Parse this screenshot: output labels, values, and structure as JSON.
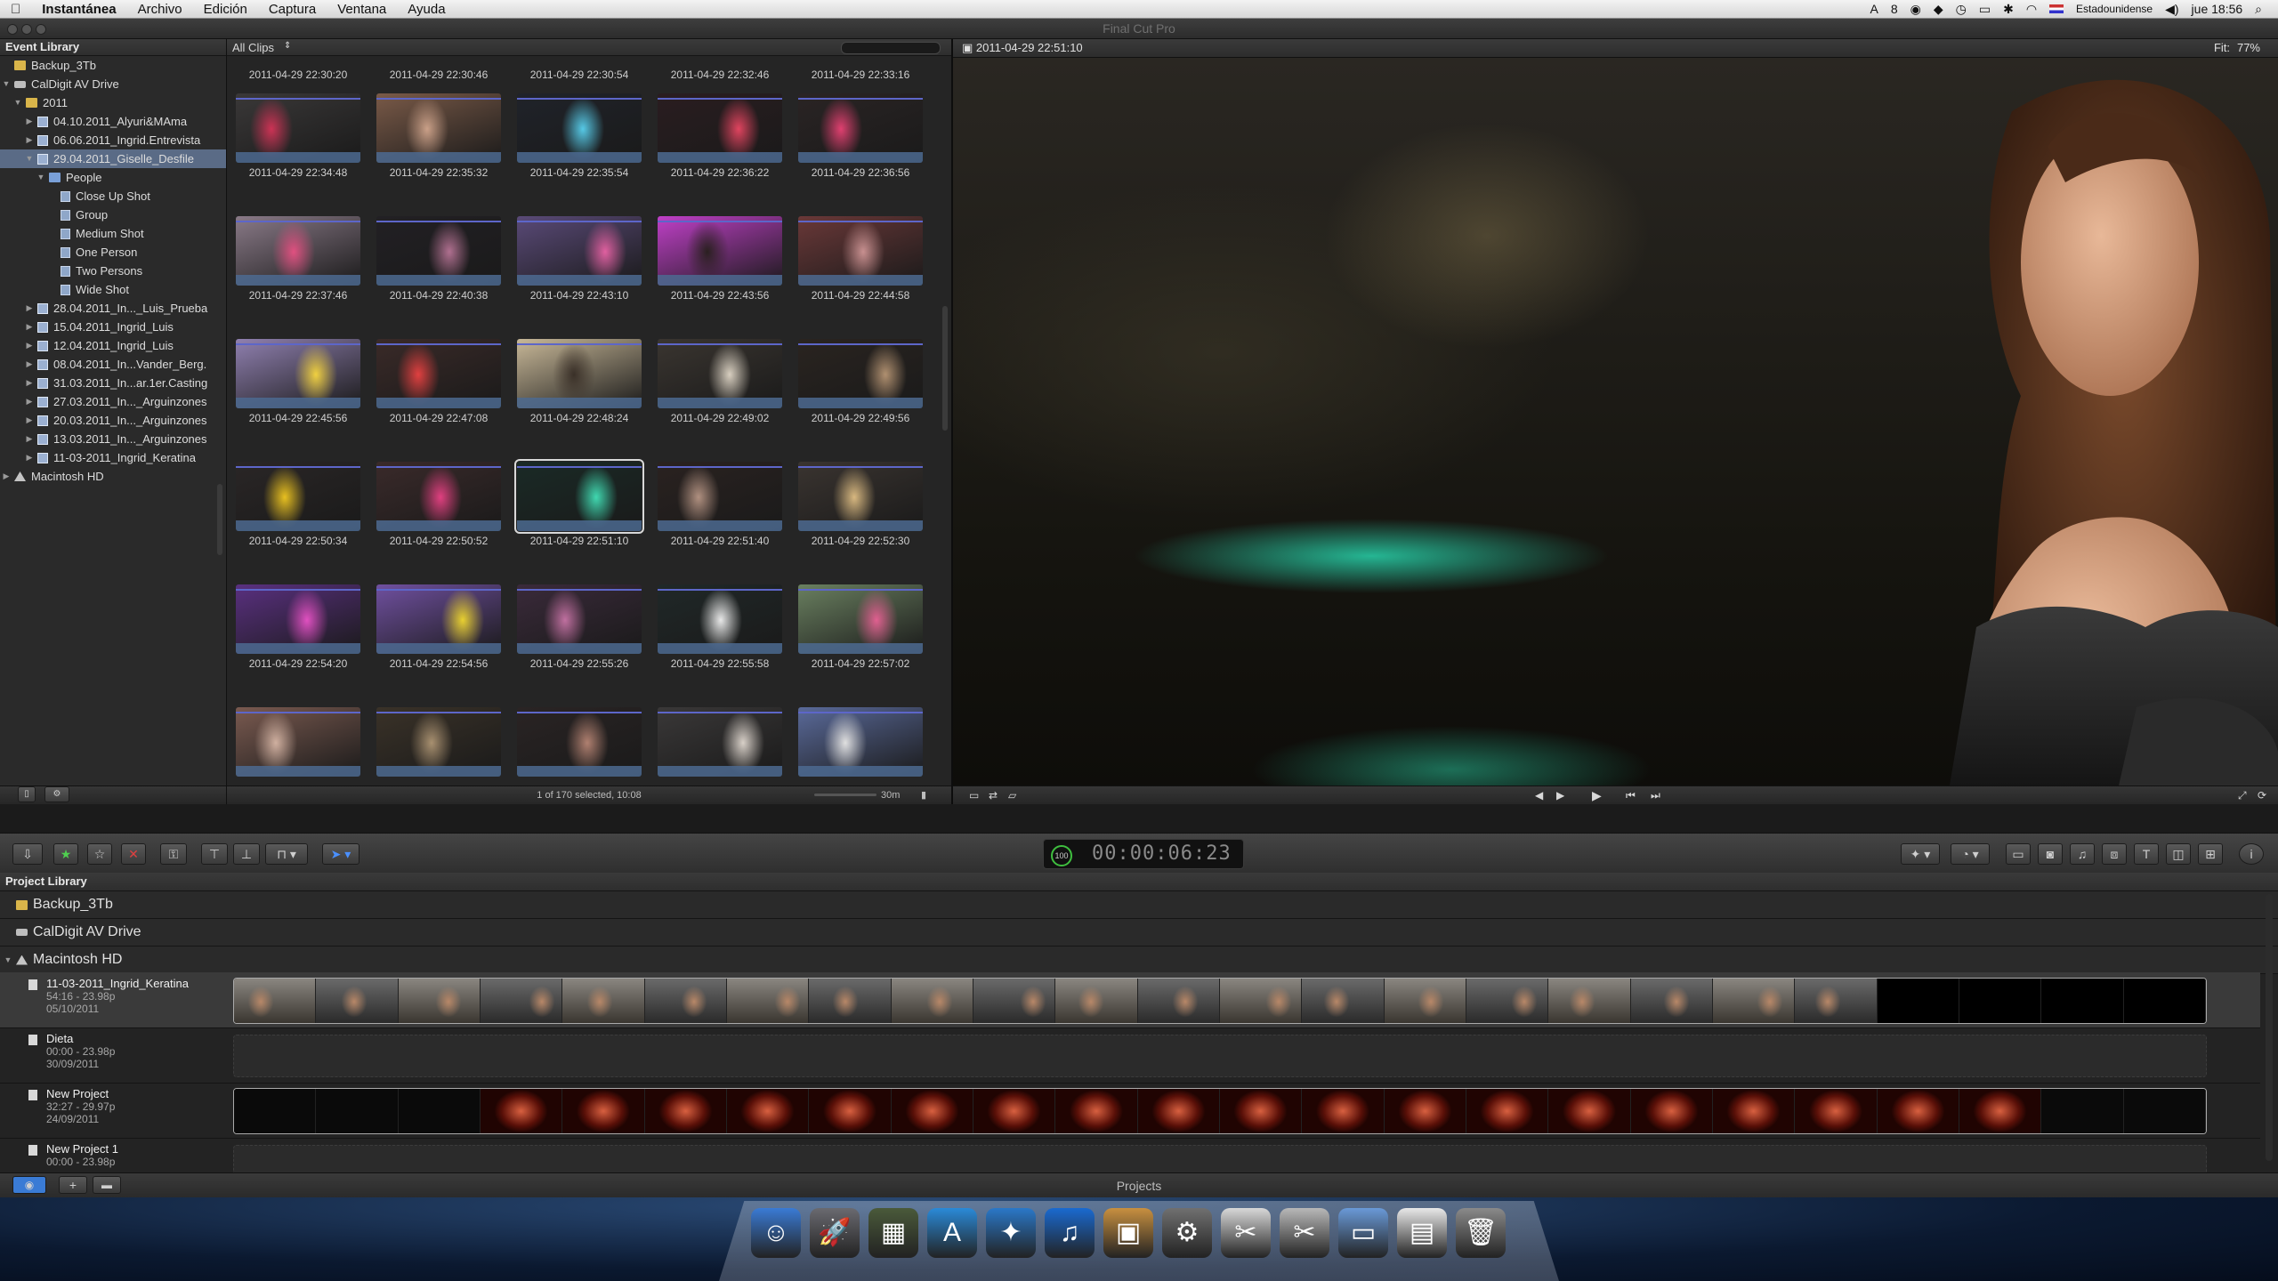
{
  "menubar": {
    "apple": "",
    "app": "Instantánea",
    "items": [
      "Archivo",
      "Edición",
      "Captura",
      "Ventana",
      "Ayuda"
    ],
    "status_count": "8",
    "input_source": "Estadounidense",
    "clock": "jue 18:56"
  },
  "window": {
    "title": "Final Cut Pro"
  },
  "event_library": {
    "title": "Event Library",
    "rows": [
      {
        "label": "Backup_3Tb",
        "icon": "folder",
        "indent": 0,
        "tri": ""
      },
      {
        "label": "CalDigit AV Drive",
        "icon": "drive",
        "indent": 0,
        "tri": "▼"
      },
      {
        "label": "2011",
        "icon": "folder",
        "indent": 1,
        "tri": "▼"
      },
      {
        "label": "04.10.2011_Alyuri&MAma",
        "icon": "event",
        "indent": 2,
        "tri": "▶"
      },
      {
        "label": "06.06.2011_Ingrid.Entrevista",
        "icon": "event",
        "indent": 2,
        "tri": "▶"
      },
      {
        "label": "29.04.2011_Giselle_Desfile",
        "icon": "event",
        "indent": 2,
        "tri": "▼",
        "selected": true
      },
      {
        "label": "People",
        "icon": "folder-blue",
        "indent": 3,
        "tri": "▼"
      },
      {
        "label": "Close Up Shot",
        "icon": "kw",
        "indent": 4,
        "tri": ""
      },
      {
        "label": "Group",
        "icon": "kw",
        "indent": 4,
        "tri": ""
      },
      {
        "label": "Medium Shot",
        "icon": "kw",
        "indent": 4,
        "tri": ""
      },
      {
        "label": "One Person",
        "icon": "kw",
        "indent": 4,
        "tri": ""
      },
      {
        "label": "Two Persons",
        "icon": "kw",
        "indent": 4,
        "tri": ""
      },
      {
        "label": "Wide Shot",
        "icon": "kw",
        "indent": 4,
        "tri": ""
      },
      {
        "label": "28.04.2011_In..._Luis_Prueba",
        "icon": "event",
        "indent": 2,
        "tri": "▶"
      },
      {
        "label": "15.04.2011_Ingrid_Luis",
        "icon": "event",
        "indent": 2,
        "tri": "▶"
      },
      {
        "label": "12.04.2011_Ingrid_Luis",
        "icon": "event",
        "indent": 2,
        "tri": "▶"
      },
      {
        "label": "08.04.2011_In...Vander_Berg.",
        "icon": "event",
        "indent": 2,
        "tri": "▶"
      },
      {
        "label": "31.03.2011_In...ar.1er.Casting",
        "icon": "event",
        "indent": 2,
        "tri": "▶"
      },
      {
        "label": "27.03.2011_In..._Arguinzones",
        "icon": "event",
        "indent": 2,
        "tri": "▶"
      },
      {
        "label": "20.03.2011_In..._Arguinzones",
        "icon": "event",
        "indent": 2,
        "tri": "▶"
      },
      {
        "label": "13.03.2011_In..._Arguinzones",
        "icon": "event",
        "indent": 2,
        "tri": "▶"
      },
      {
        "label": "11-03-2011_Ingrid_Keratina",
        "icon": "event",
        "indent": 2,
        "tri": "▶"
      },
      {
        "label": "Macintosh HD",
        "icon": "hd",
        "indent": 0,
        "tri": "▶"
      }
    ]
  },
  "browser": {
    "filter": "All Clips",
    "top_labels": [
      "2011-04-29 22:30:20",
      "2011-04-29 22:30:46",
      "2011-04-29 22:30:54",
      "2011-04-29 22:32:46",
      "2011-04-29 22:33:16"
    ],
    "clips": [
      {
        "label": "2011-04-29 22:34:48",
        "c1": "#3a3838",
        "c2": "#cc3355"
      },
      {
        "label": "2011-04-29 22:35:32",
        "c1": "#7a5a48",
        "c2": "#caa088"
      },
      {
        "label": "2011-04-29 22:35:54",
        "c1": "#20232a",
        "c2": "#56c9e6"
      },
      {
        "label": "2011-04-29 22:36:22",
        "c1": "#2a1d20",
        "c2": "#e0445f"
      },
      {
        "label": "2011-04-29 22:36:56",
        "c1": "#2a2424",
        "c2": "#e04070"
      },
      {
        "label": "2011-04-29 22:37:46",
        "c1": "#8a7a88",
        "c2": "#e05080"
      },
      {
        "label": "2011-04-29 22:40:38",
        "c1": "#222024",
        "c2": "#b07090"
      },
      {
        "label": "2011-04-29 22:43:10",
        "c1": "#5a4a78",
        "c2": "#e060a0"
      },
      {
        "label": "2011-04-29 22:43:56",
        "c1": "#c040c8",
        "c2": "#2a2020"
      },
      {
        "label": "2011-04-29 22:44:58",
        "c1": "#6a3838",
        "c2": "#c89090"
      },
      {
        "label": "2011-04-29 22:45:56",
        "c1": "#9080b0",
        "c2": "#f0d040"
      },
      {
        "label": "2011-04-29 22:47:08",
        "c1": "#3a2a28",
        "c2": "#e04040"
      },
      {
        "label": "2011-04-29 22:48:24",
        "c1": "#c8b898",
        "c2": "#3a3028"
      },
      {
        "label": "2011-04-29 22:49:02",
        "c1": "#3a3530",
        "c2": "#d8cfc0"
      },
      {
        "label": "2011-04-29 22:49:56",
        "c1": "#2a2420",
        "c2": "#b09070"
      },
      {
        "label": "2011-04-29 22:50:34",
        "c1": "#2a2626",
        "c2": "#e8c020"
      },
      {
        "label": "2011-04-29 22:50:52",
        "c1": "#3a2a2a",
        "c2": "#e04080"
      },
      {
        "label": "2011-04-29 22:51:10",
        "c1": "#1a2a26",
        "c2": "#40d8b0",
        "selected": true
      },
      {
        "label": "2011-04-29 22:51:40",
        "c1": "#2a2220",
        "c2": "#b09080"
      },
      {
        "label": "2011-04-29 22:52:30",
        "c1": "#3a3430",
        "c2": "#d8b880"
      },
      {
        "label": "2011-04-29 22:54:20",
        "c1": "#5a3080",
        "c2": "#e050c0"
      },
      {
        "label": "2011-04-29 22:54:56",
        "c1": "#7050a0",
        "c2": "#e8d030"
      },
      {
        "label": "2011-04-29 22:55:26",
        "c1": "#3a2a3a",
        "c2": "#c070a0"
      },
      {
        "label": "2011-04-29 22:55:58",
        "c1": "#202828",
        "c2": "#e8e8e8"
      },
      {
        "label": "2011-04-29 22:57:02",
        "c1": "#6a8060",
        "c2": "#e06090"
      },
      {
        "label": "",
        "c1": "#7a5a50",
        "c2": "#d0b0a0"
      },
      {
        "label": "",
        "c1": "#3a3228",
        "c2": "#a89070"
      },
      {
        "label": "",
        "c1": "#2a2424",
        "c2": "#b08070"
      },
      {
        "label": "",
        "c1": "#3a3838",
        "c2": "#d8d0c8"
      },
      {
        "label": "",
        "c1": "#5a6a9a",
        "c2": "#e0e0e0"
      }
    ],
    "status": "1 of 170 selected, 10:08",
    "duration": "30m"
  },
  "viewer": {
    "timestamp": "2011-04-29 22:51:10",
    "fit_label": "Fit:",
    "fit_value": "77%"
  },
  "toolbar": {
    "timecode": "00:00:06:23",
    "timecode_pct": "100"
  },
  "project_library": {
    "title": "Project Library",
    "drives": [
      "Backup_3Tb",
      "CalDigit AV Drive",
      "Macintosh HD"
    ],
    "projects": [
      {
        "name": "11-03-2011_Ingrid_Keratina",
        "info": "54:16 - 23.98p",
        "date": "05/10/2011",
        "strip": "people",
        "selected": true
      },
      {
        "name": "Dieta",
        "info": "00:00 - 23.98p",
        "date": "30/09/2011",
        "strip": "empty"
      },
      {
        "name": "New Project",
        "info": "32:27 - 29.97p",
        "date": "24/09/2011",
        "strip": "titles"
      },
      {
        "name": "New Project 1",
        "info": "00:00 - 23.98p",
        "date": "",
        "strip": "empty"
      }
    ],
    "footer": "Projects"
  },
  "dock": {
    "items": [
      {
        "name": "finder-icon",
        "glyph": "☺",
        "bg": "#3a7bd5"
      },
      {
        "name": "launchpad-icon",
        "glyph": "🚀",
        "bg": "#6a6a70"
      },
      {
        "name": "dashboard-icon",
        "glyph": "▦",
        "bg": "#4a5a3a"
      },
      {
        "name": "app-store-icon",
        "glyph": "A",
        "bg": "#2a8ad8"
      },
      {
        "name": "safari-icon",
        "glyph": "✦",
        "bg": "#2a78c8"
      },
      {
        "name": "itunes-icon",
        "glyph": "♫",
        "bg": "#1a6ad0"
      },
      {
        "name": "iphoto-icon",
        "glyph": "▣",
        "bg": "#c89040"
      },
      {
        "name": "system-preferences-icon",
        "glyph": "⚙",
        "bg": "#707070"
      },
      {
        "name": "final-cut-pro-icon",
        "glyph": "✂",
        "bg": "#d8d8d8"
      },
      {
        "name": "scissors-app-icon",
        "glyph": "✂",
        "bg": "#b8b8b8"
      },
      {
        "name": "applications-folder-icon",
        "glyph": "▭",
        "bg": "#6a9ad8"
      },
      {
        "name": "document-icon",
        "glyph": "▤",
        "bg": "#e8e8e8"
      },
      {
        "name": "trash-icon",
        "glyph": "🗑",
        "bg": "#8a8a8a"
      }
    ]
  }
}
